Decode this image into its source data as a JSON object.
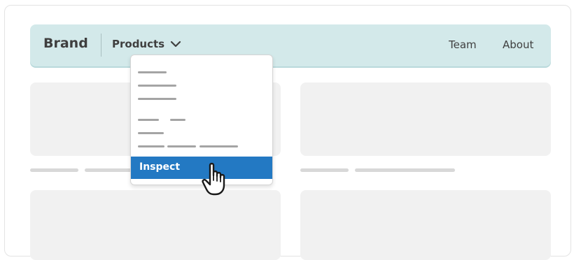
{
  "navbar": {
    "brand": "Brand",
    "products_label": "Products",
    "links": [
      "Team",
      "About"
    ]
  },
  "dropdown": {
    "selected_item": "Inspect"
  },
  "icons": {
    "products_chevron": "chevron-down-icon",
    "cursor": "hand-pointer-icon"
  },
  "colors": {
    "navbar_bg": "#d3e9ea",
    "highlight": "#2379c3",
    "placeholder": "#f1f1f1"
  }
}
